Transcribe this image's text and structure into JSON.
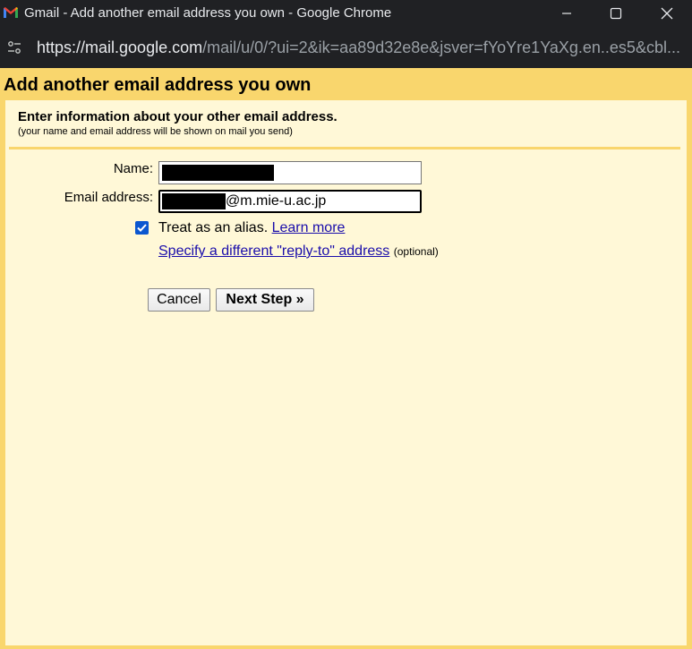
{
  "window": {
    "title": "Gmail - Add another email address you own - Google Chrome",
    "address_host": "https://mail.google.com",
    "address_path": "/mail/u/0/?ui=2&ik=aa89d32e8e&jsver=fYoYre1YaXg.en..es5&cbl..."
  },
  "dialog": {
    "title": "Add another email address you own",
    "intro_title": "Enter information about your other email address.",
    "intro_sub": "(your name and email address will be shown on mail you send)"
  },
  "form": {
    "name_label": "Name:",
    "email_label": "Email address:",
    "email_value": "@m.mie-u.ac.jp",
    "alias_checked": true,
    "alias_label": "Treat as an alias.",
    "learn_more": "Learn more",
    "reply_to_link": "Specify a different \"reply-to\" address",
    "optional": "(optional)"
  },
  "buttons": {
    "cancel": "Cancel",
    "next": "Next Step »"
  },
  "colors": {
    "accent": "#f9d66d",
    "background": "#fff8d7",
    "link": "#1a0dab",
    "checkbox": "#0b57d0"
  },
  "icons": [
    "gmail-logo-icon",
    "minimize-icon",
    "maximize-icon",
    "close-icon",
    "site-info-icon",
    "checkmark-icon"
  ]
}
